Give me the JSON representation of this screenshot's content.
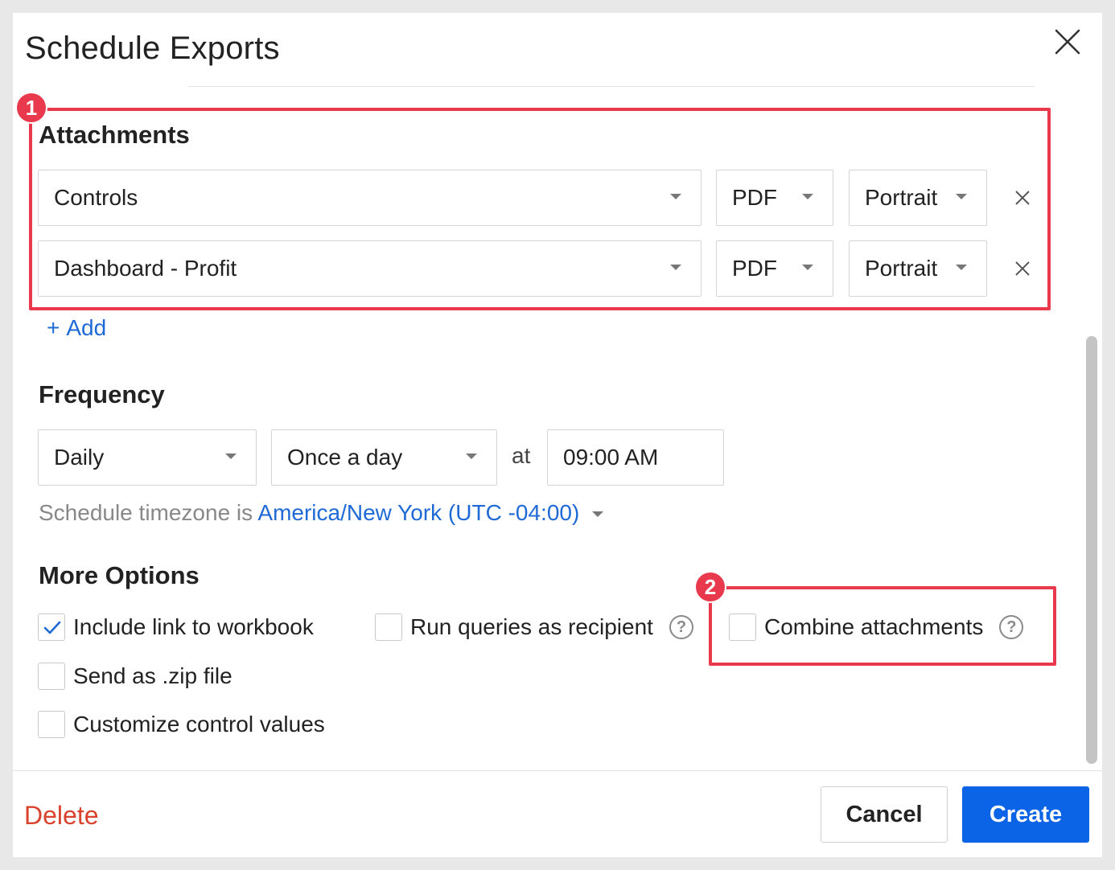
{
  "dialog": {
    "title": "Schedule Exports",
    "close_icon": "close-icon"
  },
  "attachments": {
    "heading": "Attachments",
    "rows": [
      {
        "source": "Controls",
        "format": "PDF",
        "orientation": "Portrait"
      },
      {
        "source": "Dashboard - Profit",
        "format": "PDF",
        "orientation": "Portrait"
      }
    ],
    "add_label": "Add",
    "add_icon": "+"
  },
  "frequency": {
    "heading": "Frequency",
    "period": "Daily",
    "repeat": "Once a day",
    "at_label": "at",
    "time": "09:00 AM",
    "timezone_prefix": "Schedule timezone is",
    "timezone": "America/New York (UTC -04:00)"
  },
  "more_options": {
    "heading": "More Options",
    "include_link": {
      "label": "Include link to workbook",
      "checked": true
    },
    "run_as_recipient": {
      "label": "Run queries as recipient",
      "checked": false
    },
    "combine": {
      "label": "Combine attachments",
      "checked": false
    },
    "zip": {
      "label": "Send as .zip file",
      "checked": false
    },
    "customize": {
      "label": "Customize control values",
      "checked": false
    },
    "help_glyph": "?"
  },
  "footer": {
    "delete_label": "Delete",
    "cancel_label": "Cancel",
    "create_label": "Create"
  },
  "annotations": {
    "badge_1": "1",
    "badge_2": "2",
    "highlight_color": "#e83a4c"
  },
  "colors": {
    "accent": "#0b63e6",
    "link": "#1f69d6",
    "danger": "#d9432d"
  }
}
